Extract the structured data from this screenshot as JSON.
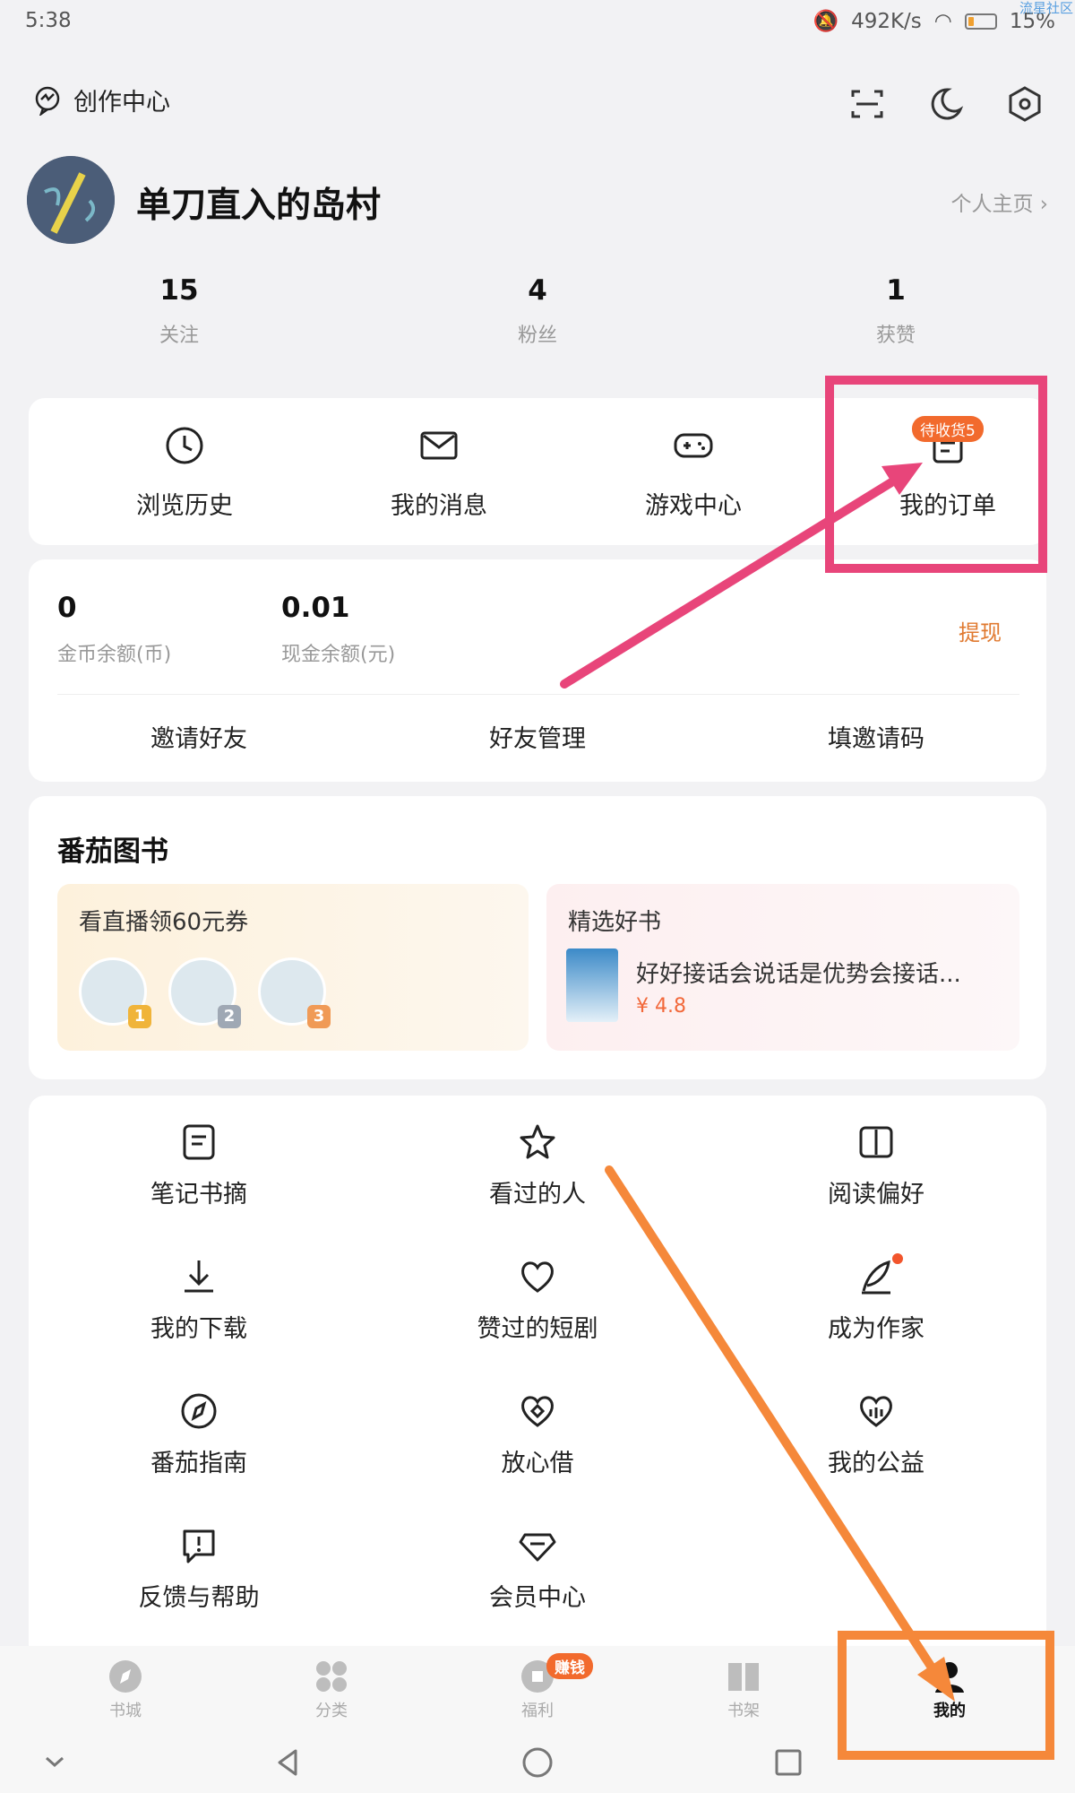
{
  "status_bar": {
    "time": "5:38",
    "net_speed": "492K/s",
    "battery": "15%",
    "watermark": "流星社区"
  },
  "header": {
    "creator_center": "创作中心",
    "icons": [
      "scan-icon",
      "night-mode-icon",
      "settings-icon"
    ]
  },
  "profile": {
    "username": "单刀直入的岛村",
    "homepage_link": "个人主页 ›"
  },
  "stats": [
    {
      "value": "15",
      "label": "关注"
    },
    {
      "value": "4",
      "label": "粉丝"
    },
    {
      "value": "1",
      "label": "获赞"
    }
  ],
  "quick_actions": [
    {
      "label": "浏览历史",
      "icon": "clock-icon"
    },
    {
      "label": "我的消息",
      "icon": "mail-icon"
    },
    {
      "label": "游戏中心",
      "icon": "gamepad-icon"
    },
    {
      "label": "我的订单",
      "icon": "order-icon",
      "badge": "待收货5"
    }
  ],
  "wallet": {
    "coins_value": "0",
    "coins_label": "金币余额(币)",
    "cash_value": "0.01",
    "cash_label": "现金余额(元)",
    "withdraw": "提现",
    "links": [
      "邀请好友",
      "好友管理",
      "填邀请码"
    ]
  },
  "books": {
    "title": "番茄图书",
    "live_promo": {
      "title": "看直播领60元券",
      "ranks": [
        "1",
        "2",
        "3"
      ]
    },
    "featured": {
      "title": "精选好书",
      "book_title": "好好接话会说话是优势会接话...",
      "price": "¥ 4.8"
    }
  },
  "grid_menu": [
    {
      "label": "笔记书摘",
      "icon": "note-icon"
    },
    {
      "label": "看过的人",
      "icon": "star-icon"
    },
    {
      "label": "阅读偏好",
      "icon": "book-icon"
    },
    {
      "label": "我的下载",
      "icon": "download-icon"
    },
    {
      "label": "赞过的短剧",
      "icon": "heart-icon"
    },
    {
      "label": "成为作家",
      "icon": "quill-icon"
    },
    {
      "label": "番茄指南",
      "icon": "compass-icon"
    },
    {
      "label": "放心借",
      "icon": "loan-icon"
    },
    {
      "label": "我的公益",
      "icon": "charity-icon"
    },
    {
      "label": "反馈与帮助",
      "icon": "feedback-icon"
    },
    {
      "label": "会员中心",
      "icon": "diamond-icon"
    }
  ],
  "tab_bar": [
    {
      "label": "书城",
      "icon": "compass-tab-icon"
    },
    {
      "label": "分类",
      "icon": "category-tab-icon"
    },
    {
      "label": "福利",
      "icon": "welfare-tab-icon",
      "badge": "赚钱"
    },
    {
      "label": "书架",
      "icon": "bookshelf-tab-icon"
    },
    {
      "label": "我的",
      "icon": "profile-tab-icon",
      "active": true
    }
  ],
  "colors": {
    "annotation_pink": "#e8457a",
    "annotation_orange": "#f5883a",
    "accent_orange": "#f26a2d"
  }
}
